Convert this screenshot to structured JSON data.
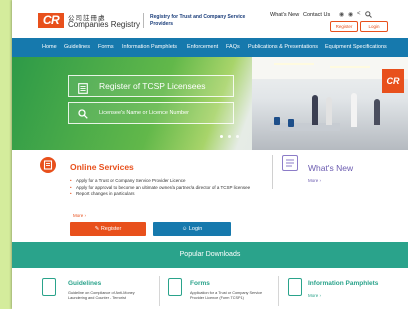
{
  "colors": {
    "brand_orange": "#e8501c",
    "nav_blue": "#1679ad",
    "teal": "#2aa38b",
    "purple": "#6b5bb0"
  },
  "edge_text": "",
  "header": {
    "logo_letters": "CR",
    "logo_chinese": "公司註冊處",
    "logo_english": "Companies Registry",
    "subtitle": "Registry for Trust and Company Service Providers",
    "links": [
      "What's New",
      "Contact Us"
    ],
    "icons": [
      "font-size-icon",
      "font-size-icon",
      "share-icon",
      "search-icon"
    ],
    "register_label": "Register",
    "login_label": "Login"
  },
  "nav": {
    "items": [
      "Home",
      "Guidelines",
      "Forms",
      "Information Pamphlets",
      "Enforcement",
      "FAQs",
      "Publications & Presentations",
      "Equipment Specifications"
    ]
  },
  "hero": {
    "register_tcsp": "Register of TCSP Licensees",
    "search_placeholder": "Licensee's Name or Licence Number",
    "building_logo": "CR",
    "slide_count": 3
  },
  "online_services": {
    "title": "Online Services",
    "items": [
      "Apply for a Trust or Company Service Provider Licence",
      "Apply for approval to become an ultimate owner/a partner/a director of a TCSP licensee",
      "Report changes in particulars"
    ],
    "more": "More ›",
    "register_button": "Register",
    "login_button": "Login"
  },
  "whats_new": {
    "title": "What's New",
    "more": "More ›"
  },
  "popular": {
    "title": "Popular Downloads",
    "items": [
      {
        "title": "Guidelines",
        "text": "Guideline on Compliance of Anti-Money Laundering and Counter - Terrorist",
        "more": ""
      },
      {
        "title": "Forms",
        "text": "Application for a Trust or Company Service Provider Licence (Form TCSP1)",
        "more": ""
      },
      {
        "title": "Information Pamphlets",
        "text": "",
        "more": "More ›"
      }
    ]
  }
}
